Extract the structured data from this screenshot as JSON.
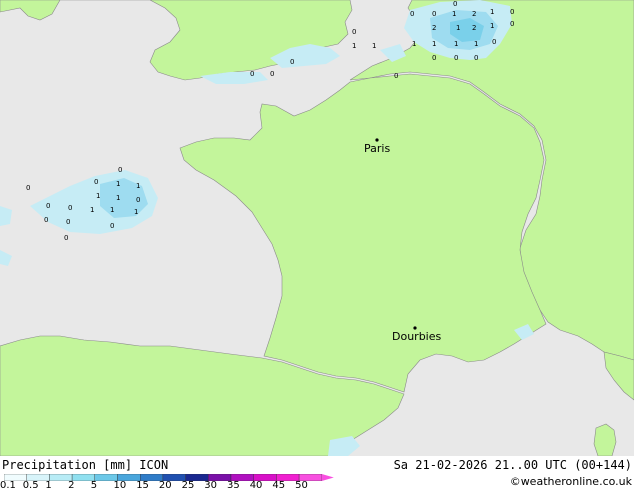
{
  "map": {
    "colors": {
      "sea": "#e8e8e8",
      "land": "#c3f59b",
      "border": "#8a8a8a",
      "precip_light": "#c6ecf5",
      "precip_mid": "#9edcf0",
      "precip_strong": "#7ad0ea"
    },
    "cities": [
      {
        "name": "Paris"
      },
      {
        "name": "Dourbies"
      }
    ],
    "values": [
      "0",
      "0",
      "0",
      "1",
      "2",
      "1",
      "0",
      "1",
      "2",
      "1",
      "2",
      "0",
      "1",
      "1",
      "1",
      "1",
      "1",
      "1",
      "0",
      "0",
      "0",
      "0",
      "0",
      "0",
      "0",
      "0",
      "0",
      "1",
      "1",
      "0",
      "0",
      "0",
      "1",
      "1",
      "0",
      "1",
      "1",
      "1",
      "0",
      "0",
      "0",
      "0",
      "0",
      "0"
    ]
  },
  "footer": {
    "title": "Precipitation [mm] ICON",
    "valid": "Sa 21-02-2026 21..00 UTC (00+144)",
    "credit": "©weatheronline.co.uk",
    "scale_labels": [
      "0.1",
      "0.5",
      "1",
      "2",
      "5",
      "10",
      "15",
      "20",
      "25",
      "30",
      "35",
      "40",
      "45",
      "50"
    ],
    "scale_colors": [
      "#f0fcfe",
      "#d8f4fa",
      "#b8ecf6",
      "#90e0f0",
      "#6cc8e8",
      "#4aa6dc",
      "#2f7cc8",
      "#2050b0",
      "#1a2890",
      "#7a10a8",
      "#b010c0",
      "#d810c8",
      "#f020d0",
      "#f850e0"
    ]
  }
}
